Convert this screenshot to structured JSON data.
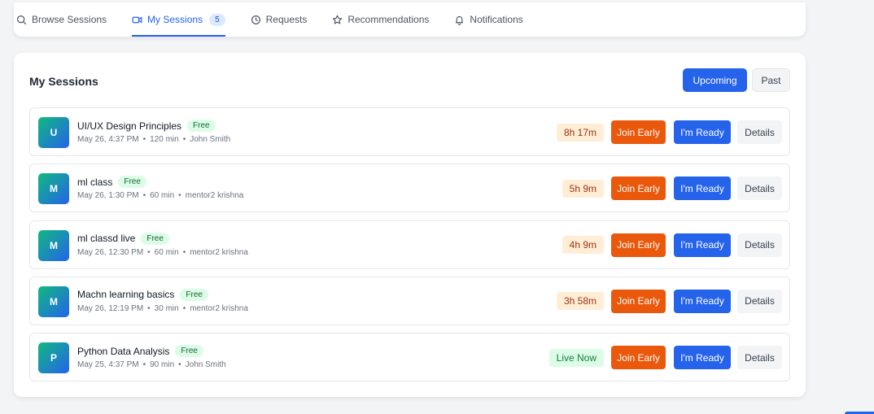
{
  "tabs": [
    {
      "label": "Browse Sessions",
      "icon": "search-icon"
    },
    {
      "label": "My Sessions",
      "icon": "video-icon",
      "badge": "5",
      "active": true
    },
    {
      "label": "Requests",
      "icon": "clock-icon"
    },
    {
      "label": "Recommendations",
      "icon": "star-icon"
    },
    {
      "label": "Notifications",
      "icon": "bell-icon"
    }
  ],
  "main": {
    "title": "My Sessions",
    "filter_upcoming": "Upcoming",
    "filter_past": "Past"
  },
  "sessions": [
    {
      "initial": "U",
      "title": "UI/UX Design Principles",
      "badge": "Free",
      "datetime": "May 26, 4:37 PM",
      "duration": "120 min",
      "host": "John Smith",
      "countdown": "8h 17m",
      "live": false,
      "join_label": "Join Early",
      "ready_label": "I'm Ready",
      "details_label": "Details"
    },
    {
      "initial": "M",
      "title": "ml class",
      "badge": "Free",
      "datetime": "May 26, 1:30 PM",
      "duration": "60 min",
      "host": "mentor2 krishna",
      "countdown": "5h 9m",
      "live": false,
      "join_label": "Join Early",
      "ready_label": "I'm Ready",
      "details_label": "Details"
    },
    {
      "initial": "M",
      "title": "ml classd live",
      "badge": "Free",
      "datetime": "May 26, 12:30 PM",
      "duration": "60 min",
      "host": "mentor2 krishna",
      "countdown": "4h 9m",
      "live": false,
      "join_label": "Join Early",
      "ready_label": "I'm Ready",
      "details_label": "Details"
    },
    {
      "initial": "M",
      "title": "Machn learning basics",
      "badge": "Free",
      "datetime": "May 26, 12:19 PM",
      "duration": "30 min",
      "host": "mentor2 krishna",
      "countdown": "3h 58m",
      "live": false,
      "join_label": "Join Early",
      "ready_label": "I'm Ready",
      "details_label": "Details"
    },
    {
      "initial": "P",
      "title": "Python Data Analysis",
      "badge": "Free",
      "datetime": "May 25, 4:37 PM",
      "duration": "90 min",
      "host": "John Smith",
      "countdown": "Live Now",
      "live": true,
      "join_label": "Join Early",
      "ready_label": "I'm Ready",
      "details_label": "Details"
    }
  ],
  "colors": {
    "accent": "#2563eb",
    "join": "#ea580c",
    "free_badge": "#dcfce7",
    "countdown_bg": "#ffedd5",
    "live_bg": "#dcfce7"
  }
}
